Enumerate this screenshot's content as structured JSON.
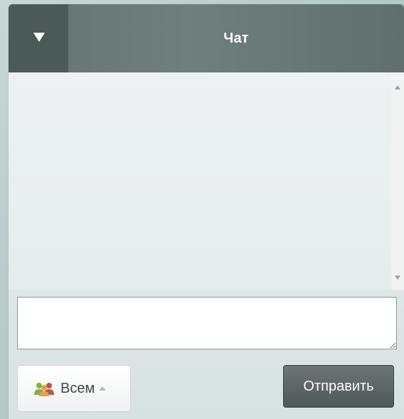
{
  "header": {
    "title": "Чат",
    "collapse_icon": "triangle-down-icon"
  },
  "messages": {
    "items": []
  },
  "input": {
    "value": "",
    "placeholder": ""
  },
  "recipient": {
    "label": "Всем",
    "icon": "people-icon",
    "caret_icon": "caret-up-icon"
  },
  "send": {
    "label": "Отправить"
  },
  "colors": {
    "header_bg": "#6f7f7c",
    "collapse_bg": "#4b5a58",
    "send_bg": "#5a6462"
  }
}
